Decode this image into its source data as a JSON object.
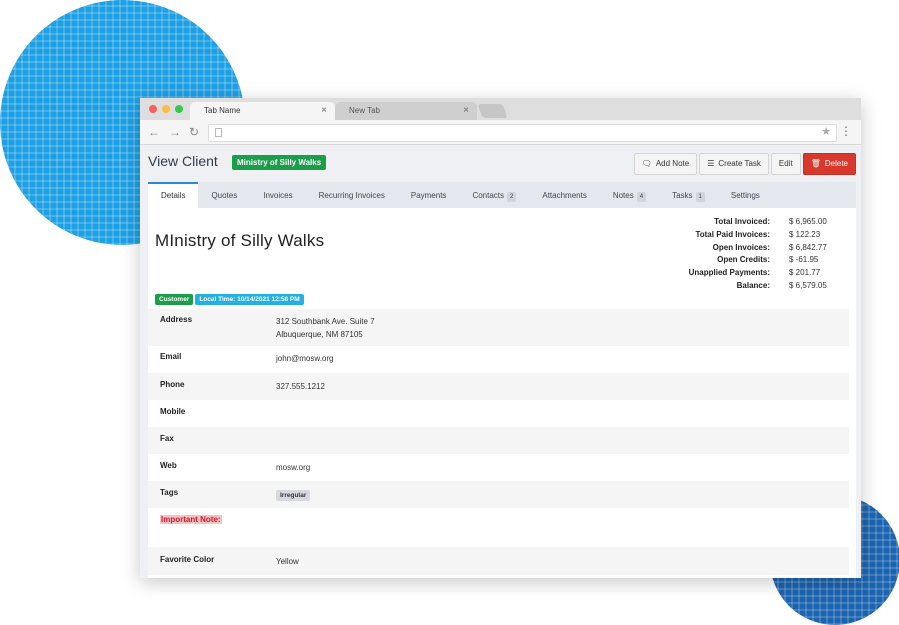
{
  "browser": {
    "tabs": [
      {
        "label": "Tab Name",
        "active": true
      },
      {
        "label": "New Tab",
        "active": false
      }
    ],
    "close_glyph": "×",
    "icons": [
      "back-arrow-icon",
      "forward-arrow-icon",
      "reload-icon",
      "page-icon",
      "bookmark-star-icon",
      "menu-dots-icon"
    ]
  },
  "header": {
    "title": "View Client",
    "client_badge": "Ministry of Silly Walks",
    "actions": {
      "add_note": "Add Note",
      "create_task": "Create Task",
      "edit": "Edit",
      "delete": "Delete"
    }
  },
  "nav": {
    "tabs": [
      {
        "label": "Details",
        "count": ""
      },
      {
        "label": "Quotes",
        "count": ""
      },
      {
        "label": "Invoices",
        "count": ""
      },
      {
        "label": "Recurring Invoices",
        "count": ""
      },
      {
        "label": "Payments",
        "count": ""
      },
      {
        "label": "Contacts",
        "count": "2"
      },
      {
        "label": "Attachments",
        "count": ""
      },
      {
        "label": "Notes",
        "count": "4"
      },
      {
        "label": "Tasks",
        "count": "1"
      },
      {
        "label": "Settings",
        "count": ""
      }
    ],
    "active": "Details"
  },
  "client": {
    "name": "MInistry of Silly Walks",
    "status_badge": "Customer",
    "local_time_badge": "Local Time: 10/14/2021 12:58 PM"
  },
  "summary": [
    {
      "label": "Total Invoiced:",
      "value": "$ 6,965.00"
    },
    {
      "label": "Total Paid Invoices:",
      "value": "$ 122.23"
    },
    {
      "label": "Open Invoices:",
      "value": "$ 6,842.77"
    },
    {
      "label": "Open Credits:",
      "value": "$ -61.95"
    },
    {
      "label": "Unapplied Payments:",
      "value": "$ 201.77"
    },
    {
      "label": "Balance:",
      "value": "$ 6,579.05"
    }
  ],
  "details": {
    "address_label": "Address",
    "address_line1": "312 Southbank Ave. Suite 7",
    "address_line2": "Albuquerque, NM 87105",
    "email_label": "Email",
    "email": "john@mosw.org",
    "phone_label": "Phone",
    "phone": "327.555.1212",
    "mobile_label": "Mobile",
    "mobile": "",
    "fax_label": "Fax",
    "fax": "",
    "web_label": "Web",
    "web": "mosw.org",
    "tags_label": "Tags",
    "tag": "Irregular",
    "important_note_label": "Important Note:",
    "favorite_color_label": "Favorite Color",
    "favorite_color": "Yellow"
  },
  "colors": {
    "accent": "#2a88d8",
    "badge_green": "#1b9e4a",
    "badge_cyan": "#25b0e3",
    "danger": "#d9392d"
  }
}
